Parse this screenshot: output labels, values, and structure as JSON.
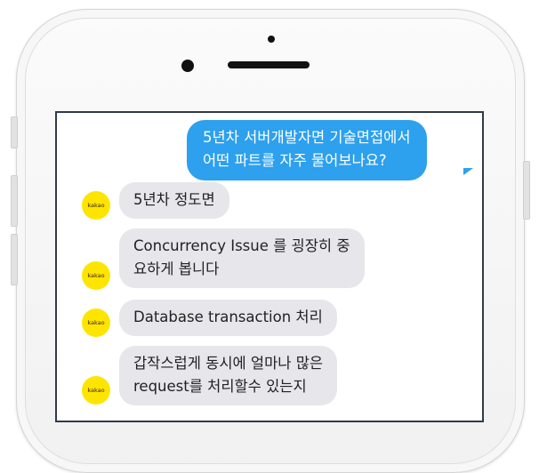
{
  "conversation": {
    "question": {
      "line1": "5년차 서버개발자면 기술면접에서",
      "line2": "어떤 파트를 자주 물어보나요?"
    },
    "replies": [
      {
        "avatar": "kakao",
        "lines": [
          "5년차 정도면"
        ]
      },
      {
        "avatar": "kakao",
        "lines": [
          "Concurrency Issue 를 굉장히 중",
          "요하게 봅니다"
        ]
      },
      {
        "avatar": "kakao",
        "lines": [
          "Database transaction 처리"
        ]
      },
      {
        "avatar": "kakao",
        "lines": [
          "갑작스럽게 동시에 얼마나 많은",
          "request를 처리할수 있는지"
        ]
      }
    ]
  },
  "colors": {
    "outgoing_bubble": "#2da0ee",
    "incoming_bubble": "#e6e6eb",
    "avatar": "#fee500"
  }
}
